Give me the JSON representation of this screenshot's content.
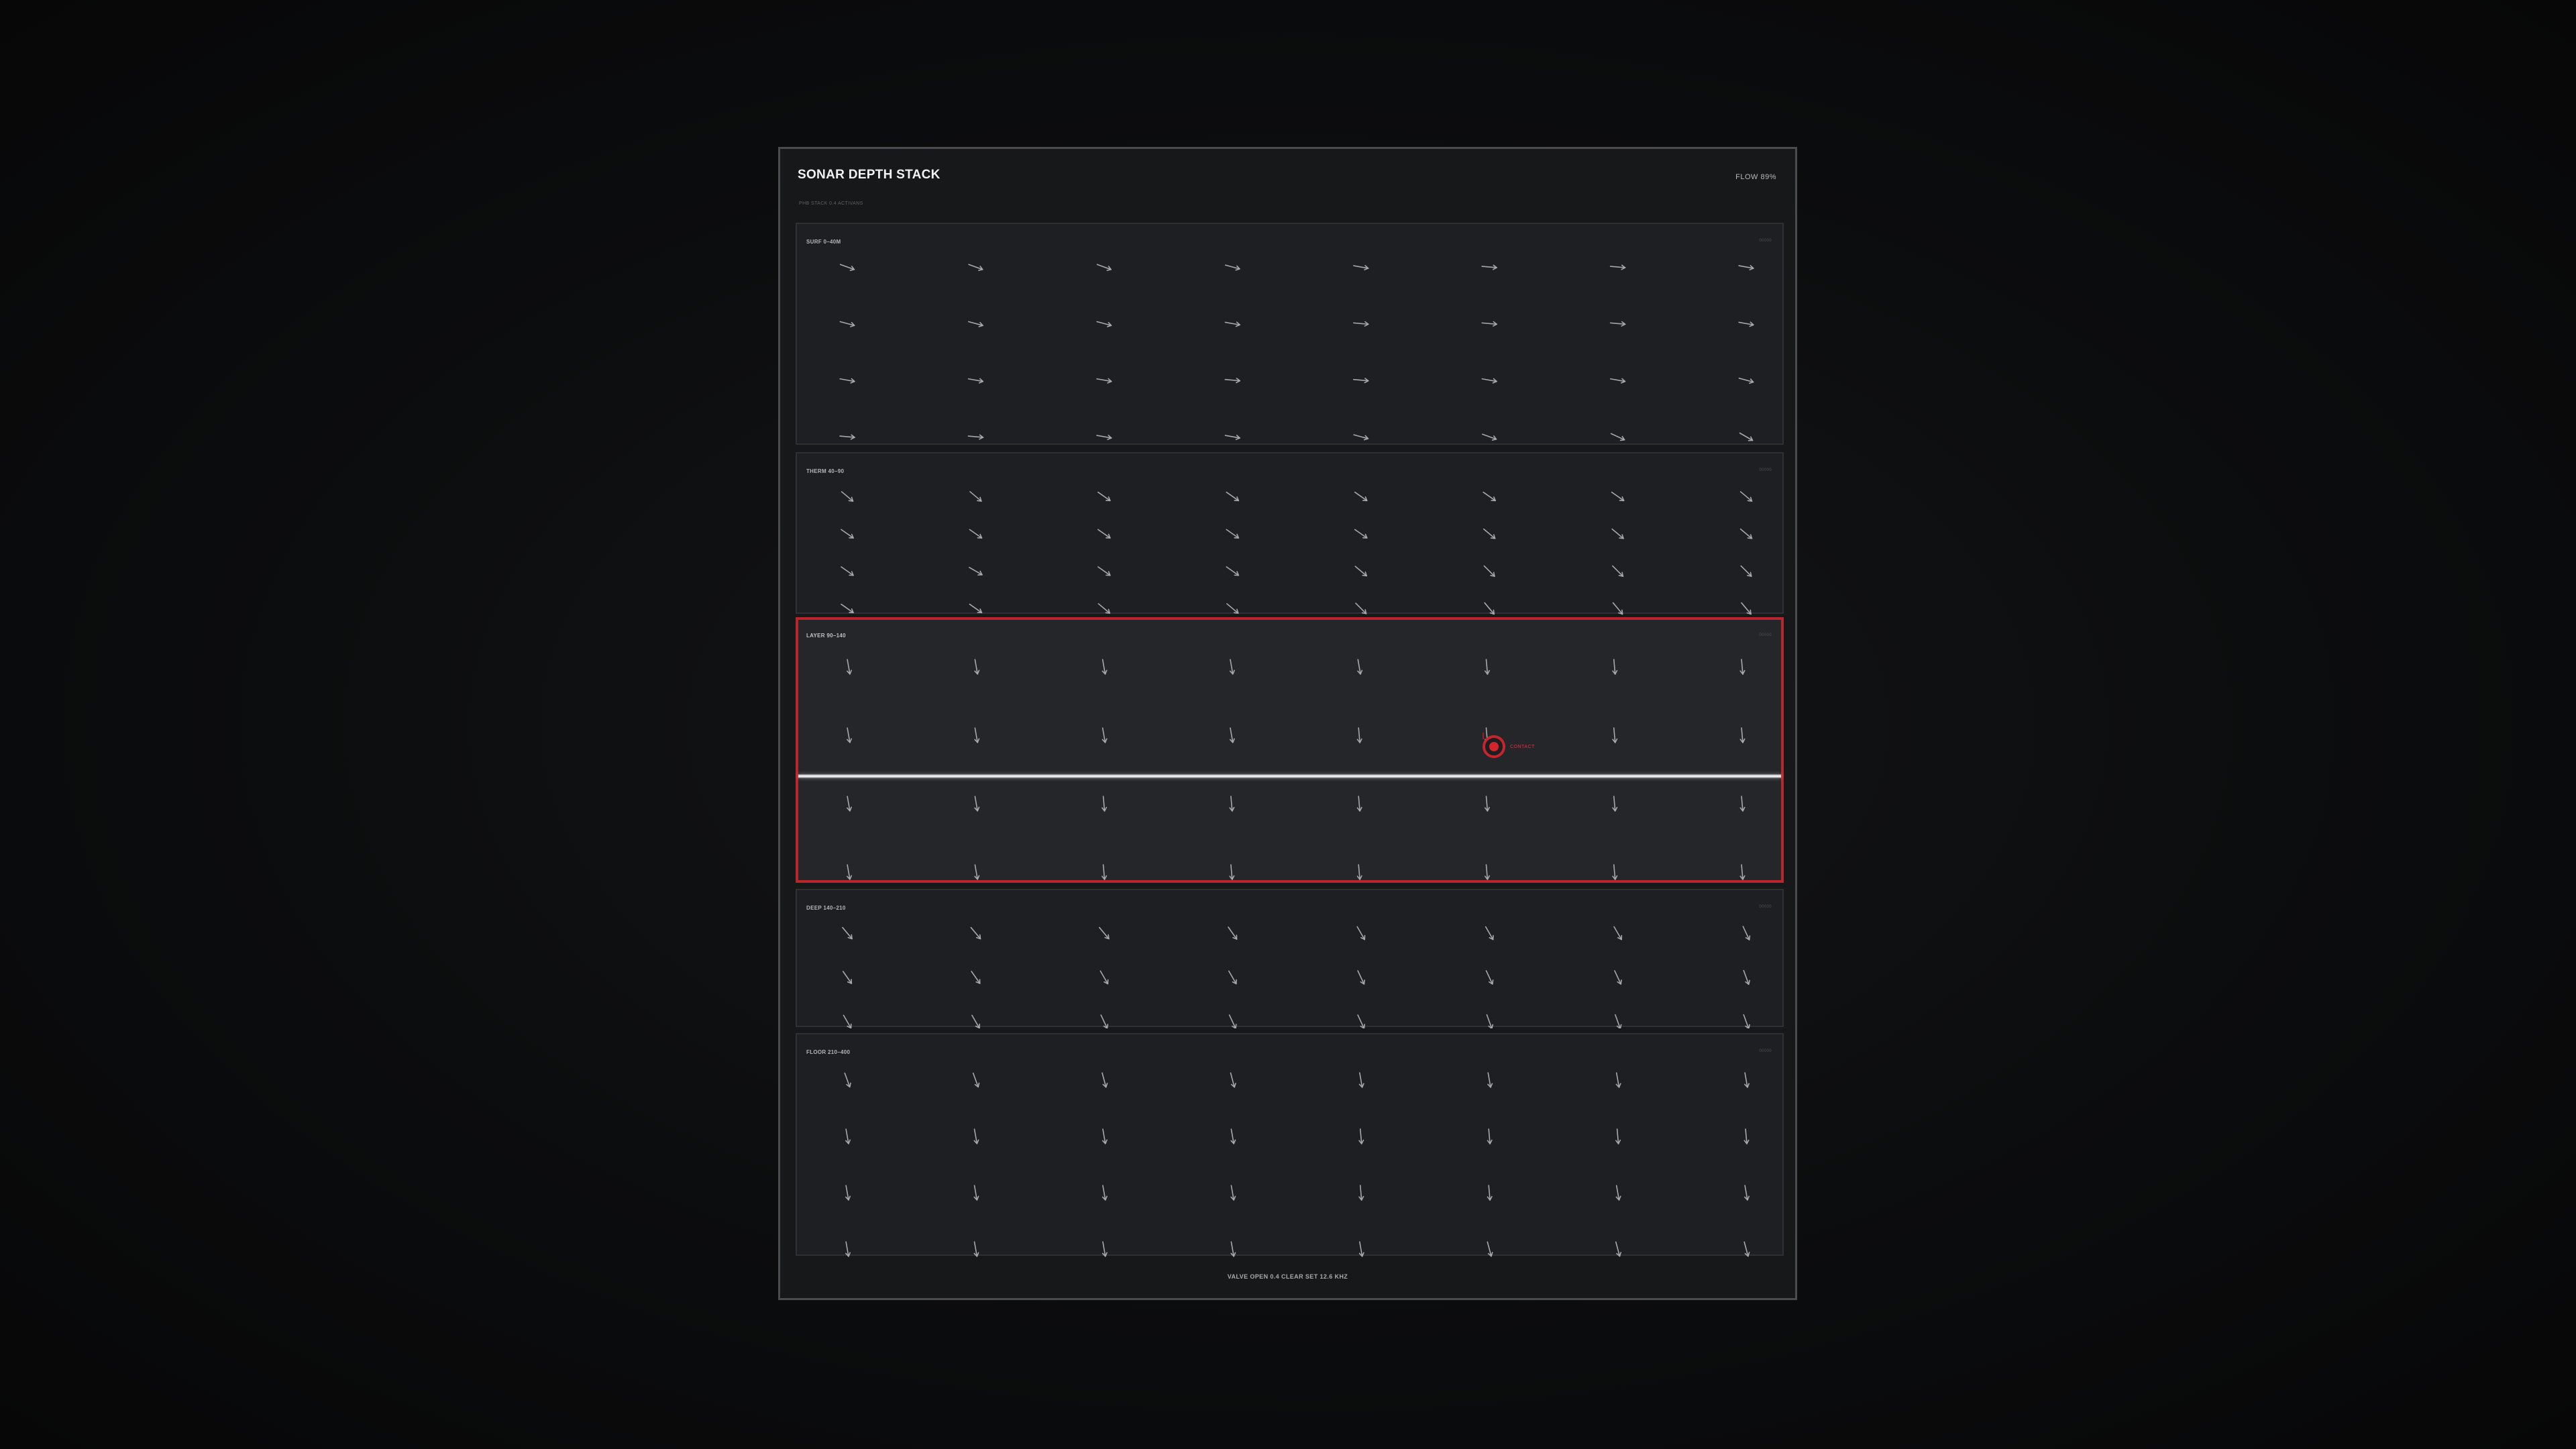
{
  "app": {
    "title": "SONAR DEPTH STACK",
    "flow_status": "FLOW 89%",
    "subtitle": "PHB STACK 0.4 ACTIVANS",
    "footer": "VALVE OPEN  0.4 CLEAR  SET 12.6 KHZ"
  },
  "colors": {
    "panel_bg": "#17181a",
    "layer_bg": "#1e1f22",
    "active_border": "#b8262b",
    "arrow": "#a8a9ac",
    "target": "#d3262c"
  },
  "layers": [
    {
      "label": "SURF 0–40M",
      "tag": "00000",
      "active": false,
      "angles": [
        [
          20,
          20,
          20,
          15,
          10,
          5,
          5,
          10
        ],
        [
          15,
          15,
          15,
          10,
          5,
          5,
          5,
          10
        ],
        [
          10,
          10,
          10,
          5,
          5,
          10,
          10,
          15
        ],
        [
          5,
          5,
          10,
          10,
          15,
          20,
          25,
          30
        ]
      ]
    },
    {
      "label": "THERM 40–90",
      "tag": "00000",
      "active": false,
      "angles": [
        [
          40,
          40,
          35,
          35,
          35,
          35,
          35,
          40
        ],
        [
          35,
          35,
          35,
          35,
          35,
          40,
          40,
          40
        ],
        [
          35,
          30,
          35,
          35,
          40,
          45,
          45,
          45
        ],
        [
          35,
          35,
          40,
          40,
          45,
          50,
          50,
          50
        ]
      ]
    },
    {
      "label": "LAYER 90–140",
      "tag": "00000",
      "active": true,
      "angles": [
        [
          80,
          80,
          80,
          80,
          80,
          85,
          85,
          85
        ],
        [
          80,
          80,
          80,
          80,
          85,
          85,
          85,
          85
        ],
        [
          80,
          80,
          85,
          85,
          85,
          85,
          85,
          85
        ],
        [
          80,
          80,
          85,
          85,
          85,
          85,
          85,
          85
        ]
      ]
    },
    {
      "label": "DEEP 140–210",
      "tag": "00000",
      "active": false,
      "angles": [
        [
          50,
          50,
          50,
          55,
          60,
          60,
          60,
          65
        ],
        [
          55,
          55,
          60,
          60,
          65,
          65,
          65,
          70
        ],
        [
          60,
          60,
          65,
          65,
          65,
          70,
          70,
          70
        ]
      ]
    },
    {
      "label": "FLOOR 210–400",
      "tag": "00000",
      "active": false,
      "angles": [
        [
          70,
          70,
          75,
          75,
          80,
          80,
          80,
          80
        ],
        [
          80,
          80,
          80,
          80,
          85,
          85,
          85,
          85
        ],
        [
          80,
          80,
          80,
          80,
          85,
          85,
          80,
          80
        ],
        [
          80,
          80,
          80,
          80,
          80,
          75,
          75,
          75
        ]
      ]
    }
  ],
  "target": {
    "label": "CONTACT",
    "icon": "target-icon"
  },
  "thermocline": {
    "icon": "thermocline-line"
  }
}
